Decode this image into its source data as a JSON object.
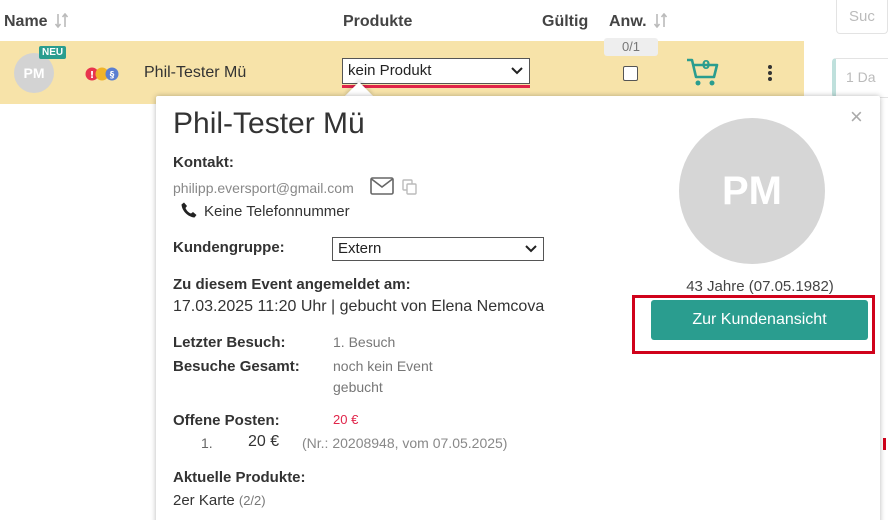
{
  "table_header": {
    "name": "Name",
    "produkte": "Produkte",
    "gueltig": "Gültig",
    "anw": "Anw.",
    "anw_count": "0/1"
  },
  "row": {
    "avatar_initials": "PM",
    "new_badge": "NEU",
    "name": "Phil-Tester Mü",
    "product_selected": "kein Produkt",
    "cart_count": "0"
  },
  "side": {
    "search_placeholder": "Suc",
    "day_stub": "1 Da"
  },
  "popup": {
    "title": "Phil-Tester Mü",
    "contact_label": "Kontakt:",
    "email": "philipp.eversport@gmail.com",
    "phone": "Keine Telefonnummer",
    "group_label": "Kundengruppe:",
    "group_selected": "Extern",
    "registered_label": "Zu diesem Event angemeldet am:",
    "registered_text": "17.03.2025 11:20 Uhr | gebucht von Elena Nemcova",
    "last_visit_label": "Letzter Besuch:",
    "last_visit_value": "1. Besuch",
    "total_visits_label": "Besuche Gesamt:",
    "total_visits_value_1": "noch kein Event",
    "total_visits_value_2": "gebucht",
    "open_items_label": "Offene Posten:",
    "open_items_total": "20 €",
    "open_item_no": "1.",
    "open_item_amount": "20 €",
    "open_item_ref": "(Nr.: 20208948, vom 07.05.2025)",
    "products_label": "Aktuelle Produkte:",
    "product_name": "2er Karte",
    "product_count": "(2/2)",
    "avatar_initials": "PM",
    "age": "43 Jahre (07.05.1982)",
    "customer_button": "Zur Kundenansicht"
  },
  "colors": {
    "accent": "#2a9d8f",
    "row_highlight": "#f7e3a9",
    "alert_red": "#d0021b",
    "price_red": "#e0254a"
  }
}
